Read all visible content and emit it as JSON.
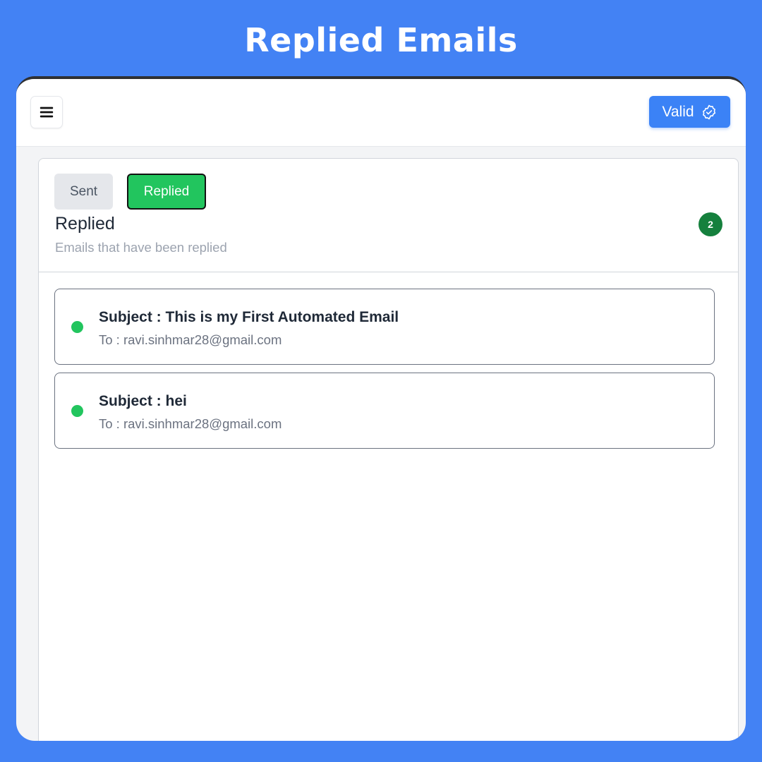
{
  "banner": {
    "title": "Replied Emails"
  },
  "topbar": {
    "menu_icon": "hamburger-menu-icon",
    "valid_label": "Valid",
    "valid_icon": "badge-check-icon",
    "accent_color": "#3b82f6"
  },
  "tabs": [
    {
      "label": "Sent",
      "active": false
    },
    {
      "label": "Replied",
      "active": true
    }
  ],
  "section": {
    "title": "Replied",
    "subtitle": "Emails that have been replied",
    "count": "2"
  },
  "emails": [
    {
      "subject": "Subject : This is my First Automated Email",
      "to": "To : ravi.sinhmar28@gmail.com",
      "status_color": "#22c55e"
    },
    {
      "subject": "Subject : hei",
      "to": "To : ravi.sinhmar28@gmail.com",
      "status_color": "#22c55e"
    }
  ]
}
